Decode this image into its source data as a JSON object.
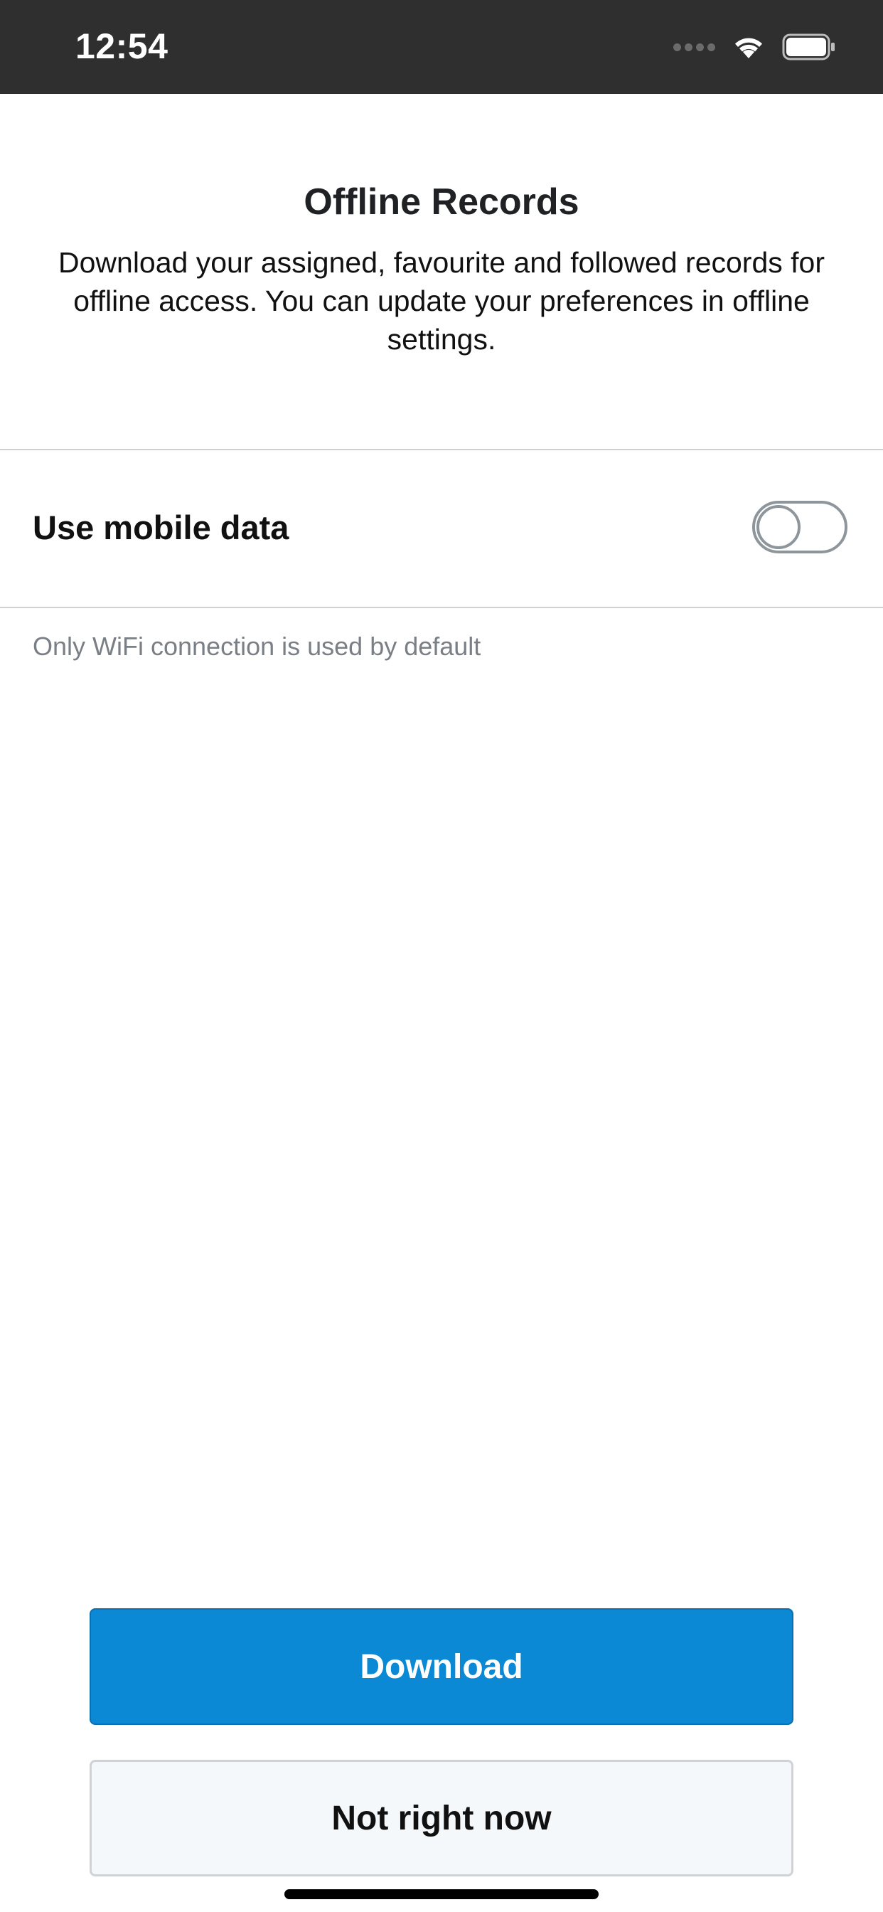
{
  "status_bar": {
    "time": "12:54",
    "icons": [
      "signal-dots-icon",
      "wifi-icon",
      "battery-icon"
    ]
  },
  "header": {
    "title": "Offline Records",
    "description": "Download your assigned, favourite and followed records for offline access. You can update your preferences in offline settings."
  },
  "settings": {
    "mobile_data_label": "Use mobile data",
    "mobile_data_enabled": false,
    "hint": "Only WiFi connection is used by default"
  },
  "actions": {
    "download_label": "Download",
    "not_now_label": "Not right now"
  },
  "colors": {
    "primary": "#0b89d4",
    "status_bar": "#2f2f2f",
    "toggle_off": "#8e969c"
  }
}
